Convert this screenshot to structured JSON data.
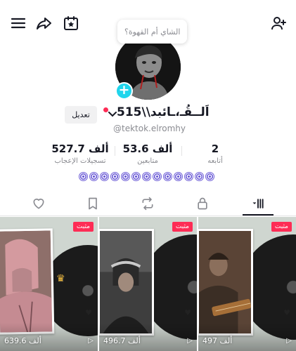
{
  "header": {
    "menu_icon": "hamburger-icon",
    "share_icon": "share-arrow-icon",
    "calendar_icon": "calendar-star-icon",
    "add_friend_icon": "add-person-icon"
  },
  "note_bubble": "الشاي أم القهوة؟",
  "profile": {
    "display_name": "اَلــقُـ،ـائبد\\\\515",
    "username": "@tektok.elromhy",
    "edit_label": "تعديل"
  },
  "stats": [
    {
      "value": "2",
      "label": "أتابعه"
    },
    {
      "value": "53.6 ألف",
      "label": "متابعين"
    },
    {
      "value": "527.7 ألف",
      "label": "تسجيلات الإعجاب"
    }
  ],
  "tabs": [
    {
      "icon": "heart-icon"
    },
    {
      "icon": "bookmark-icon"
    },
    {
      "icon": "repost-icon"
    },
    {
      "icon": "lock-icon"
    },
    {
      "icon": "grid-icon"
    }
  ],
  "videos": [
    {
      "pinned": "مثبت",
      "views": "639.6 ألف"
    },
    {
      "pinned": "مثبت",
      "views": "496.7 ألف"
    },
    {
      "pinned": "مثبت",
      "views": "497 ألف"
    }
  ],
  "colors": {
    "accent": "#20d5ec",
    "pinned": "#fe2c55",
    "text": "#161823",
    "muted": "#8a8b91"
  }
}
